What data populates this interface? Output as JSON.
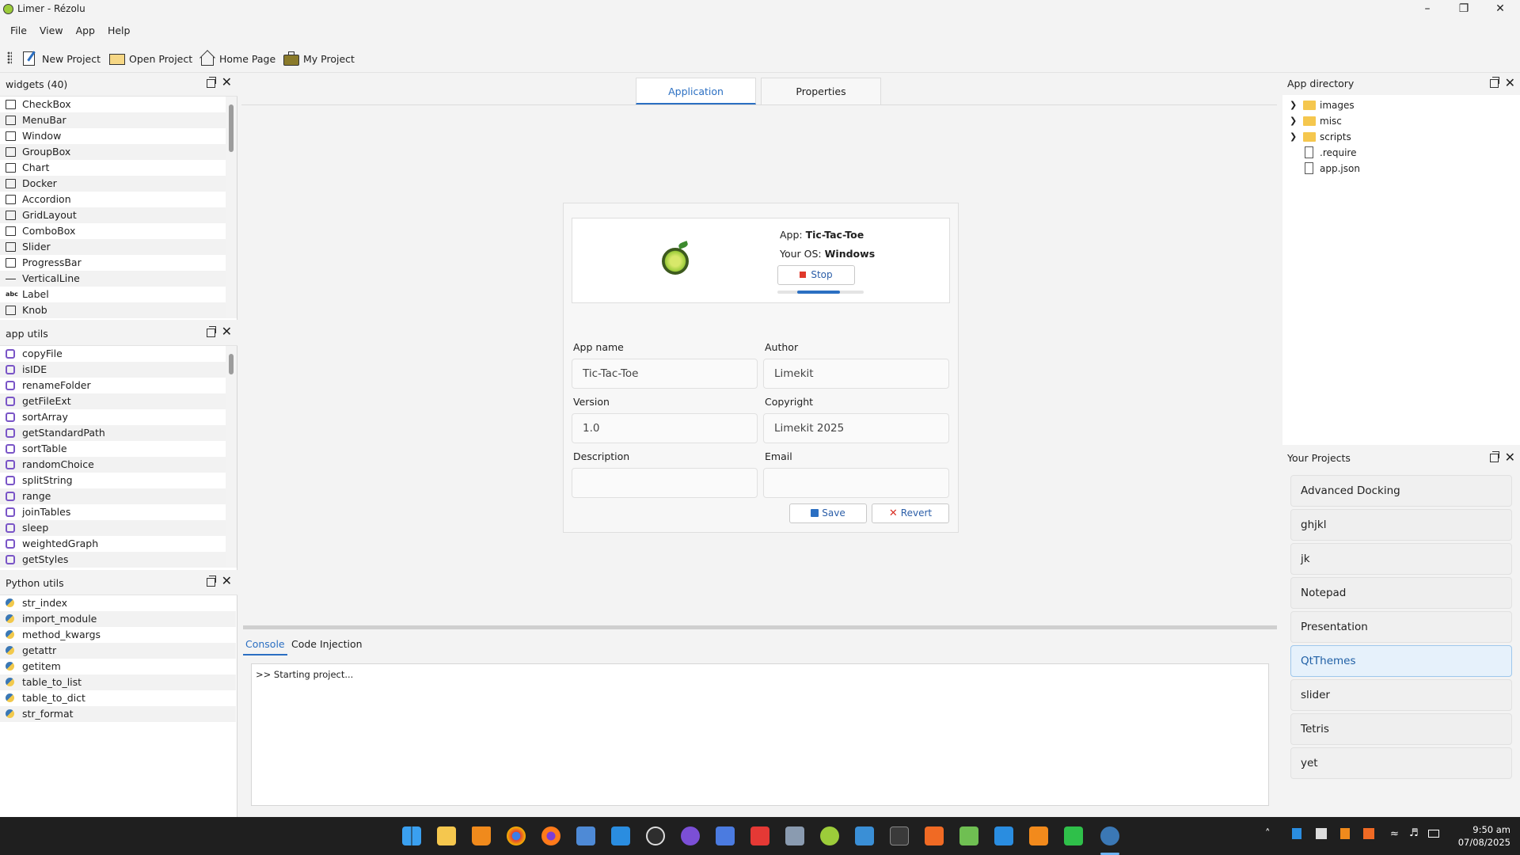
{
  "window": {
    "title": "Limer - Rézolu"
  },
  "menu": [
    "File",
    "View",
    "App",
    "Help"
  ],
  "toolbar": {
    "new_project": "New Project",
    "open_project": "Open Project",
    "home_page": "Home Page",
    "my_project": "My Project"
  },
  "widgets_panel": {
    "title": "widgets (40)",
    "items": [
      "CheckBox",
      "MenuBar",
      "Window",
      "GroupBox",
      "Chart",
      "Docker",
      "Accordion",
      "GridLayout",
      "ComboBox",
      "Slider",
      "ProgressBar",
      "VerticalLine",
      "Label",
      "Knob"
    ]
  },
  "app_utils_panel": {
    "title": "app utils",
    "items": [
      "copyFile",
      "isIDE",
      "renameFolder",
      "getFileExt",
      "sortArray",
      "getStandardPath",
      "sortTable",
      "randomChoice",
      "splitString",
      "range",
      "joinTables",
      "sleep",
      "weightedGraph",
      "getStyles"
    ]
  },
  "python_utils_panel": {
    "title": "Python utils",
    "items": [
      "str_index",
      "import_module",
      "method_kwargs",
      "getattr",
      "getitem",
      "table_to_list",
      "table_to_dict",
      "str_format"
    ]
  },
  "center_tabs": {
    "application": "Application",
    "properties": "Properties",
    "active": "Application"
  },
  "app_info": {
    "app_label": "App:",
    "app_value": "Tic-Tac-Toe",
    "os_label": "Your OS:",
    "os_value": "Windows",
    "stop_button": "Stop",
    "progress": 0.5
  },
  "form": {
    "app_name_label": "App name",
    "app_name_value": "Tic-Tac-Toe",
    "author_label": "Author",
    "author_value": "Limekit",
    "version_label": "Version",
    "version_value": "1.0",
    "copyright_label": "Copyright",
    "copyright_value": "Limekit 2025",
    "description_label": "Description",
    "description_value": "",
    "email_label": "Email",
    "email_value": "",
    "save_button": "Save",
    "revert_button": "Revert"
  },
  "console": {
    "tabs": [
      "Console",
      "Code Injection"
    ],
    "active": "Console",
    "output": ">> Starting project..."
  },
  "app_directory": {
    "title": "App directory",
    "entries": [
      {
        "name": "images",
        "type": "folder"
      },
      {
        "name": "misc",
        "type": "folder"
      },
      {
        "name": "scripts",
        "type": "folder"
      },
      {
        "name": ".require",
        "type": "file"
      },
      {
        "name": "app.json",
        "type": "file"
      }
    ]
  },
  "your_projects": {
    "title": "Your Projects",
    "items": [
      "Advanced Docking",
      "ghjkl",
      "jk",
      "Notepad",
      "Presentation",
      "QtThemes",
      "slider",
      "Tetris",
      "yet"
    ],
    "selected": "QtThemes"
  },
  "taskbar": {
    "time": "9:50 am",
    "date": "07/08/2025"
  },
  "colors": {
    "accent": "#2b6fc2",
    "stop_red": "#e0392b",
    "revert_red": "#d93025",
    "lime": "#9ccc3a",
    "folder": "#f5c74e"
  }
}
